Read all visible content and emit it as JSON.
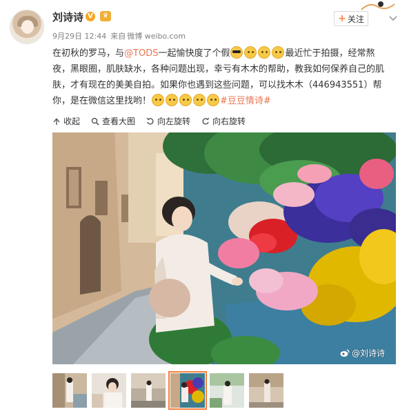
{
  "user": {
    "name": "刘诗诗",
    "verified_badge": "V"
  },
  "follow_button": {
    "plus": "+",
    "label": "关注"
  },
  "meta": {
    "date": "9月29日 12:44",
    "source_prefix": "来自",
    "source": "微博 weibo.com"
  },
  "content": {
    "part1": "在初秋的罗马，与",
    "mention": "@TODS",
    "part2": "一起愉快度了个假",
    "part3": "最近忙于拍摄，经常熬夜，黑眼圈，肌肤缺水，各种问题出现，幸亏有木木的帮助，教我如何保养自己的肌肤，才有现在的美美自拍。如果你也遇到这些问题，可以找木木（446943551）帮你，是在微信这里找哟！",
    "topic": "#豆豆情诗#"
  },
  "actions": [
    {
      "label": "收起",
      "icon": "collapse-arrow-icon"
    },
    {
      "label": "查看大图",
      "icon": "magnifier-icon"
    },
    {
      "label": "向左旋转",
      "icon": "rotate-left-icon"
    },
    {
      "label": "向右旋转",
      "icon": "rotate-right-icon"
    }
  ],
  "watermark": "@刘诗诗",
  "thumbnails_count": 6,
  "active_thumbnail": 4,
  "colors": {
    "accent": "#eb7350",
    "follow_plus": "#ff8140",
    "meta_gray": "#808080",
    "active_border": "#fa7d3c"
  }
}
